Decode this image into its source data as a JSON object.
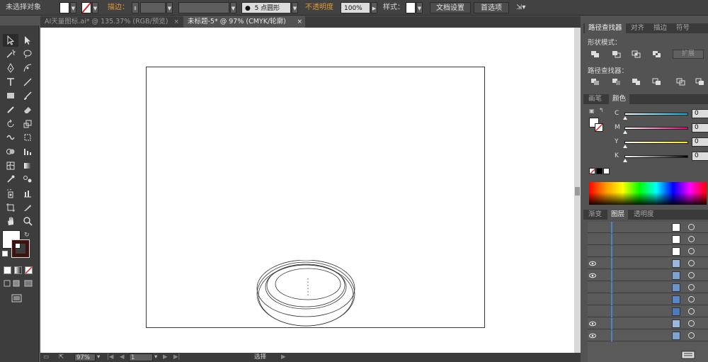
{
  "control_bar": {
    "selection_label": "未选择对象",
    "stroke_label": "描边：",
    "brush_label": "5 点圆形",
    "opacity_label": "不透明度",
    "opacity_value": "100%",
    "style_label": "样式：",
    "doc_setup_button": "文档设置",
    "prefs_button": "首选项"
  },
  "tabs": [
    {
      "label": "AI天量图标.ai* @ 135.37% (RGB/预览)",
      "close": "×"
    },
    {
      "label": "未标题-5* @ 97% (CMYK/轮廓)",
      "close": "×"
    }
  ],
  "status_bar": {
    "zoom": "97%",
    "page": "1",
    "mode": "选择"
  },
  "pathfinder_panel": {
    "tabs": [
      "路径查找器",
      "对齐",
      "描边",
      "符号"
    ],
    "shape_modes_label": "形状模式：",
    "expand_button": "扩展",
    "pathfinders_label": "路径查找器："
  },
  "color_panel": {
    "tabs": [
      "画笔",
      "颜色"
    ],
    "sliders": [
      {
        "channel": "C",
        "value": "0",
        "color": "#00b4e6"
      },
      {
        "channel": "M",
        "value": "0",
        "color": "#e6007e"
      },
      {
        "channel": "Y",
        "value": "0",
        "color": "#ffec00"
      },
      {
        "channel": "K",
        "value": "0",
        "color": "#000000"
      }
    ]
  },
  "layers_panel": {
    "tabs": [
      "渐变",
      "图层",
      "透明度"
    ]
  },
  "colors": {
    "accent_orange": "#e09a3a",
    "layer_blue": "#4a82d6"
  }
}
